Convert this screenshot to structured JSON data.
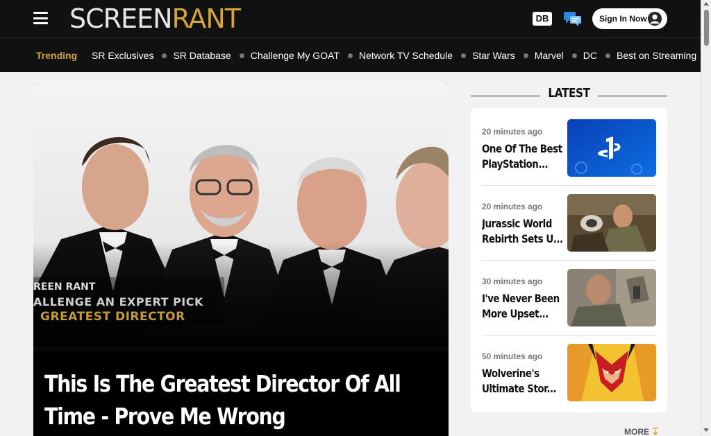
{
  "header": {
    "logo_part1": "SCREEN",
    "logo_part2": "RANT",
    "db_label": "DB",
    "signin_label": "Sign In Now",
    "icons": [
      "menu-icon",
      "database-icon",
      "chat-icon",
      "user-avatar-icon"
    ],
    "brand_color": "#d4a53b",
    "bar_color": "#111111"
  },
  "trending": {
    "label": "Trending",
    "items": [
      "SR Exclusives",
      "SR Database",
      "Challenge My GOAT",
      "Network TV Schedule",
      "Star Wars",
      "Marvel",
      "DC",
      "Best on Streaming"
    ]
  },
  "hero": {
    "overlay_brand": "REEN RANT",
    "overlay_line1": "ALLENGE AN EXPERT PICK",
    "overlay_line2": "GREATEST DIRECTOR",
    "title_line1": "This Is The Greatest Director Of All",
    "title_line2": "Time - Prove Me Wrong"
  },
  "latest": {
    "heading": "LATEST",
    "items": [
      {
        "time": "20 minutes ago",
        "line1": "One Of The Best",
        "line2": "PlayStation..."
      },
      {
        "time": "20 minutes ago",
        "line1": "Jurassic World",
        "line2": "Rebirth Sets U..."
      },
      {
        "time": "30 minutes ago",
        "line1": "I've Never Been",
        "line2": "More Upset..."
      },
      {
        "time": "50 minutes ago",
        "line1": "Wolverine's",
        "line2": "Ultimate Stor..."
      }
    ],
    "more_label": "MORE"
  }
}
